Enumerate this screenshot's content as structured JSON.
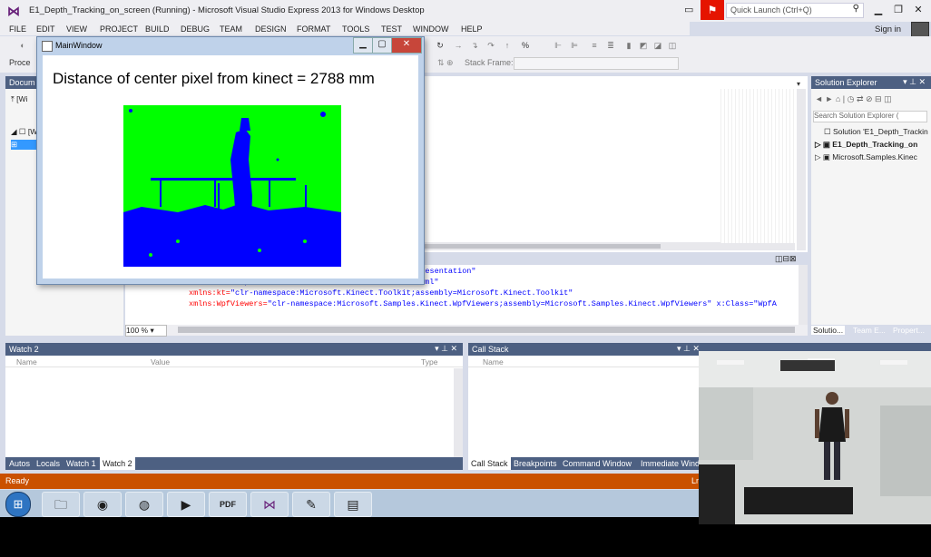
{
  "title_bar": {
    "title": "E1_Depth_Tracking_on_screen (Running) - Microsoft Visual Studio Express 2013 for Windows Desktop",
    "quick_launch_placeholder": "Quick Launch (Ctrl+Q)",
    "sign_in": "Sign in"
  },
  "menu": [
    "FILE",
    "EDIT",
    "VIEW",
    "PROJECT",
    "BUILD",
    "DEBUG",
    "TEAM",
    "DESIGN",
    "FORMAT",
    "TOOLS",
    "TEST",
    "WINDOW",
    "HELP"
  ],
  "toolbar": {
    "process_label": "Proce",
    "stack_frame_label": "Stack Frame:"
  },
  "document_outline": {
    "title": "Docum",
    "item1": "[Wi",
    "item2": "[W",
    "item3": "⊞"
  },
  "main_window": {
    "title": "MainWindow",
    "distance_text": "Distance of center pixel from kinect = 2788 mm"
  },
  "editor": {
    "zoom": "100 %",
    "code_lines": [
      {
        "attr": "",
        "value": "l/presentation\""
      },
      {
        "attr": "xmlns:x=",
        "value": "\"http://schemas.microsoft.com/winfx/2006/xaml\""
      },
      {
        "attr": "xmlns:kt=",
        "value": "\"clr-namespace:Microsoft.Kinect.Toolkit;assembly=Microsoft.Kinect.Toolkit\""
      },
      {
        "attr": "xmlns:WpfViewers=",
        "value": "\"clr-namespace:Microsoft.Samples.Kinect.WpfViewers;assembly=Microsoft.Samples.Kinect.WpfViewers\" x:Class=\"WpfA"
      }
    ]
  },
  "solution_explorer": {
    "title": "Solution Explorer",
    "search_placeholder": "Search Solution Explorer (",
    "items": [
      "Solution 'E1_Depth_Trackin",
      "E1_Depth_Tracking_on",
      "Microsoft.Samples.Kinec"
    ],
    "tabs": [
      "Solutio...",
      "Team E...",
      "Propert..."
    ]
  },
  "watch": {
    "title": "Watch 2",
    "columns": [
      "Name",
      "Value",
      "Type"
    ],
    "tabs": [
      "Autos",
      "Locals",
      "Watch 1",
      "Watch 2"
    ]
  },
  "call_stack": {
    "title": "Call Stack",
    "columns": [
      "Name"
    ],
    "tabs": [
      "Call Stack",
      "Breakpoints",
      "Command Window",
      "Immediate Wind"
    ]
  },
  "status": {
    "text": "Ready",
    "right": "Ln"
  },
  "taskbar": {
    "apps": [
      "folder",
      "chrome",
      "firefox",
      "media-player",
      "pdf",
      "visual-studio",
      "paint",
      "notepad"
    ]
  },
  "colors": {
    "accent": "#ca5100",
    "pane_header": "#4d6082",
    "depth_near": "#0000ff",
    "depth_far": "#00ff00"
  }
}
